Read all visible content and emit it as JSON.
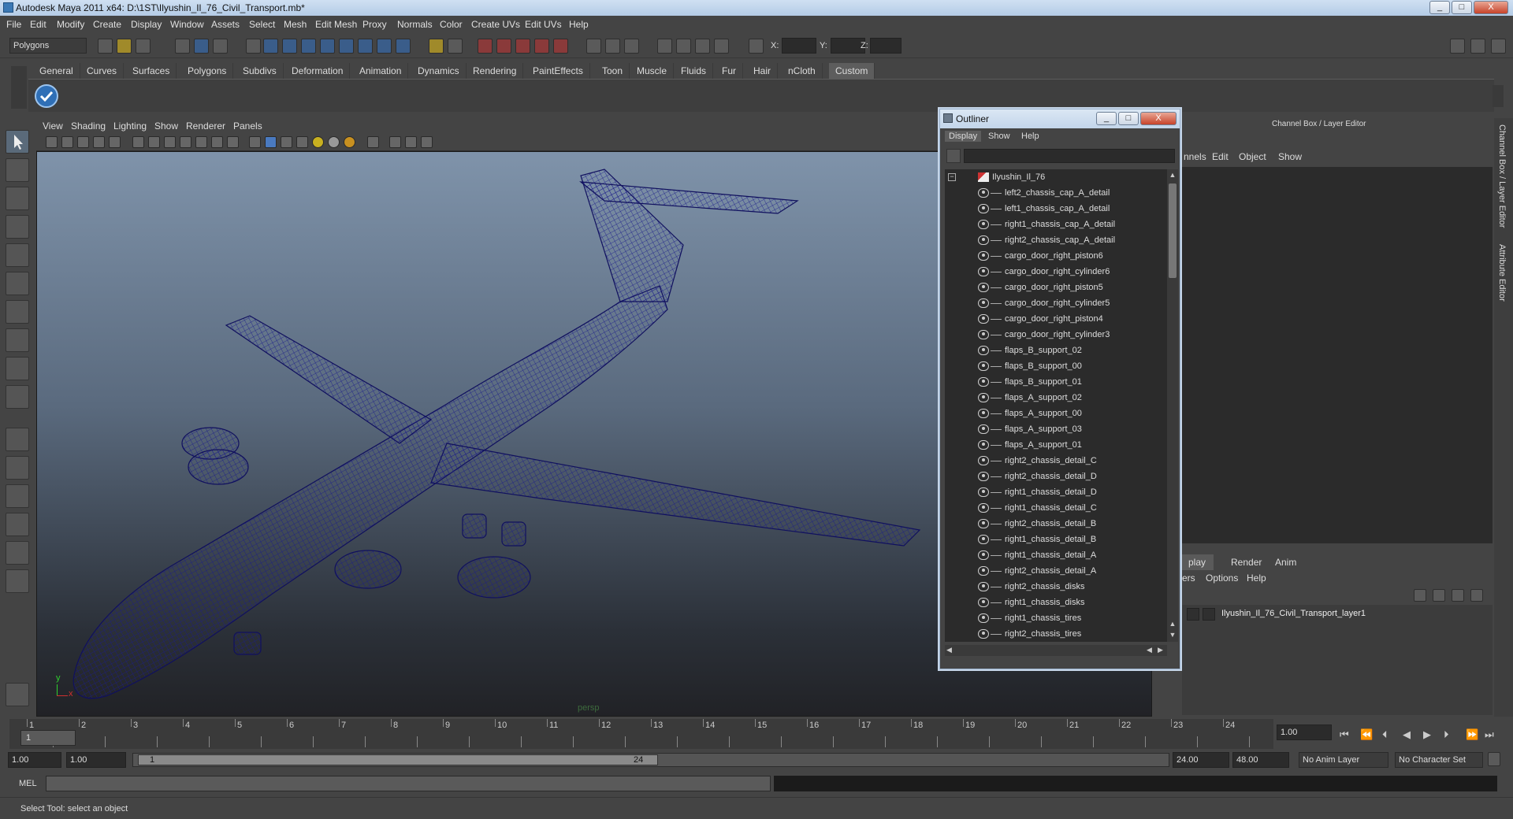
{
  "window": {
    "title": "Autodesk Maya 2011 x64: D:\\1ST\\Ilyushin_Il_76_Civil_Transport.mb*",
    "min": "_",
    "max": "□",
    "close": "X"
  },
  "menubar": [
    "File",
    "Edit",
    "Modify",
    "Create",
    "Display",
    "Window",
    "Assets",
    "Select",
    "Mesh",
    "Edit Mesh",
    "Proxy",
    "Normals",
    "Color",
    "Create UVs",
    "Edit UVs",
    "Help"
  ],
  "toolbar": {
    "mode_value": "Polygons",
    "x_label": "X:",
    "y_label": "Y:",
    "z_label": "Z:"
  },
  "shelf_tabs": [
    "General",
    "Curves",
    "Surfaces",
    "Polygons",
    "Subdivs",
    "Deformation",
    "Animation",
    "Dynamics",
    "Rendering",
    "PaintEffects",
    "Toon",
    "Muscle",
    "Fluids",
    "Fur",
    "Hair",
    "nCloth",
    "Custom"
  ],
  "shelf_active": "Custom",
  "viewport": {
    "menu": [
      "View",
      "Shading",
      "Lighting",
      "Show",
      "Renderer",
      "Panels"
    ],
    "camera_label": "persp",
    "axis_y": "y",
    "axis_x": "x",
    "wire_color": "#141470"
  },
  "channel_box": {
    "title": "Channel Box / Layer Editor",
    "menu": [
      "nnels",
      "Edit",
      "Object",
      "Show"
    ],
    "side_tabs": [
      "Channel Box / Layer Editor",
      "Attribute Editor"
    ]
  },
  "layer_editor": {
    "tabs": [
      "play",
      "Render",
      "Anim"
    ],
    "menu": [
      "ers",
      "Options",
      "Help"
    ],
    "layer_name": "Ilyushin_Il_76_Civil_Transport_layer1"
  },
  "outliner": {
    "title": "Outliner",
    "menu": [
      "Display",
      "Show",
      "Help"
    ],
    "root": "Ilyushin_Il_76",
    "items": [
      "left2_chassis_cap_A_detail",
      "left1_chassis_cap_A_detail",
      "right1_chassis_cap_A_detail",
      "right2_chassis_cap_A_detail",
      "cargo_door_right_piston6",
      "cargo_door_right_cylinder6",
      "cargo_door_right_piston5",
      "cargo_door_right_cylinder5",
      "cargo_door_right_piston4",
      "cargo_door_right_cylinder3",
      "flaps_B_support_02",
      "flaps_B_support_00",
      "flaps_B_support_01",
      "flaps_A_support_02",
      "flaps_A_support_00",
      "flaps_A_support_03",
      "flaps_A_support_01",
      "right2_chassis_detail_C",
      "right2_chassis_detail_D",
      "right1_chassis_detail_D",
      "right1_chassis_detail_C",
      "right2_chassis_detail_B",
      "right1_chassis_detail_B",
      "right1_chassis_detail_A",
      "right2_chassis_detail_A",
      "right2_chassis_disks",
      "right1_chassis_disks",
      "right1_chassis_tires",
      "right2_chassis_tires"
    ]
  },
  "timeline": {
    "ticks": [
      "1",
      "2",
      "3",
      "4",
      "5",
      "6",
      "7",
      "8",
      "9",
      "10",
      "11",
      "12",
      "13",
      "14",
      "15",
      "16",
      "17",
      "18",
      "19",
      "20",
      "21",
      "22",
      "23",
      "24"
    ],
    "current_frame_label": "1",
    "current_time": "1.00"
  },
  "range": {
    "start": "1.00",
    "anim_start": "1.00",
    "slider_start": "1",
    "slider_end": "24",
    "anim_end": "24.00",
    "end": "48.00",
    "anim_layer": "No Anim Layer",
    "char_set": "No Character Set"
  },
  "command": {
    "label": "MEL",
    "help": "Select Tool: select an object"
  }
}
